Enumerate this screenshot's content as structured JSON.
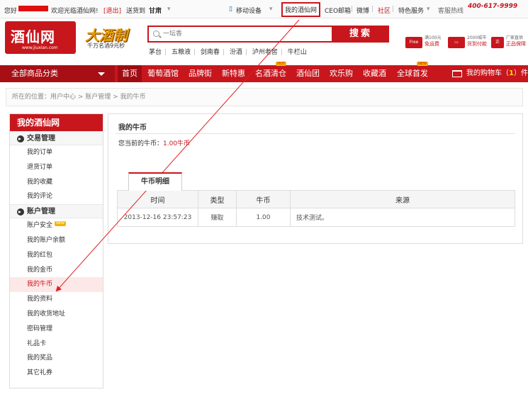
{
  "topbar": {
    "greeting": "您好",
    "welcome": "欢迎光临酒仙网!",
    "logout": "[退出]",
    "ship_to_label": "送货到",
    "ship_to_value": "甘肃",
    "mobile": "移动设备",
    "my_jxw": "我的酒仙网",
    "ceo_mail": "CEO邮箱",
    "weibo": "微博",
    "community": "社区",
    "special": "特色服务",
    "hotline_label": "客服热线",
    "hotline_number": "400-617-9999"
  },
  "header": {
    "logo_text": "酒仙网",
    "logo_sub": "www.jiuxian.com",
    "promo_big": "大酒制",
    "promo_small": "千万名酒9元秒",
    "search_placeholder": "一坛香",
    "search_button": "搜索",
    "hotwords": [
      "茅台",
      "五粮液",
      "剑南春",
      "汾酒",
      "泸州老窖",
      "牛栏山"
    ],
    "services": [
      {
        "icon": "free-shipping-icon",
        "line1": "满100元",
        "line2": "免运费"
      },
      {
        "icon": "compensation-icon",
        "line1": "2000城市",
        "line2": "货到付款"
      },
      {
        "icon": "genuine-icon",
        "line1": "厂家直供",
        "line2": "正品保障"
      }
    ]
  },
  "nav": {
    "all_categories": "全部商品分类",
    "items": [
      {
        "label": "首页",
        "active": true
      },
      {
        "label": "葡萄酒馆"
      },
      {
        "label": "品牌街"
      },
      {
        "label": "新特惠"
      },
      {
        "label": "名酒清仓",
        "badge": "HOT"
      },
      {
        "label": "酒仙团"
      },
      {
        "label": "欢乐购"
      },
      {
        "label": "收藏酒"
      },
      {
        "label": "全球首发",
        "badge": "NEW"
      }
    ],
    "cart_label": "我的购物车（",
    "cart_count": "1",
    "cart_tail": "）件"
  },
  "breadcrumb": "所在的位置：用户中心 > 账户管理 > 我的牛币",
  "sidebar": {
    "title": "我的酒仙网",
    "sections": [
      {
        "title": "交易管理",
        "items": [
          "我的订单",
          "退货订单",
          "我的收藏",
          "我的评论"
        ]
      },
      {
        "title": "账户管理",
        "items": [
          "账户安全",
          "我的账户余额",
          "我的红包",
          "我的金币",
          "我的牛币",
          "我的资料",
          "我的收货地址",
          "密码管理",
          "礼品卡",
          "我的奖品",
          "其它礼券"
        ]
      }
    ],
    "new_badge": "NEW",
    "active_item": "我的牛币"
  },
  "main": {
    "title": "我的牛币",
    "balance_label": "您当前的牛币：",
    "balance_value": "1.00牛币",
    "tab": "牛币明细",
    "columns": [
      "时间",
      "类型",
      "牛币",
      "来源"
    ],
    "rows": [
      [
        "2013-12-16 23:57:23",
        "赚取",
        "1.00",
        "技术测试。"
      ]
    ]
  },
  "colors": {
    "brand_red": "#c8161d",
    "accent_yellow": "#f6b400"
  }
}
